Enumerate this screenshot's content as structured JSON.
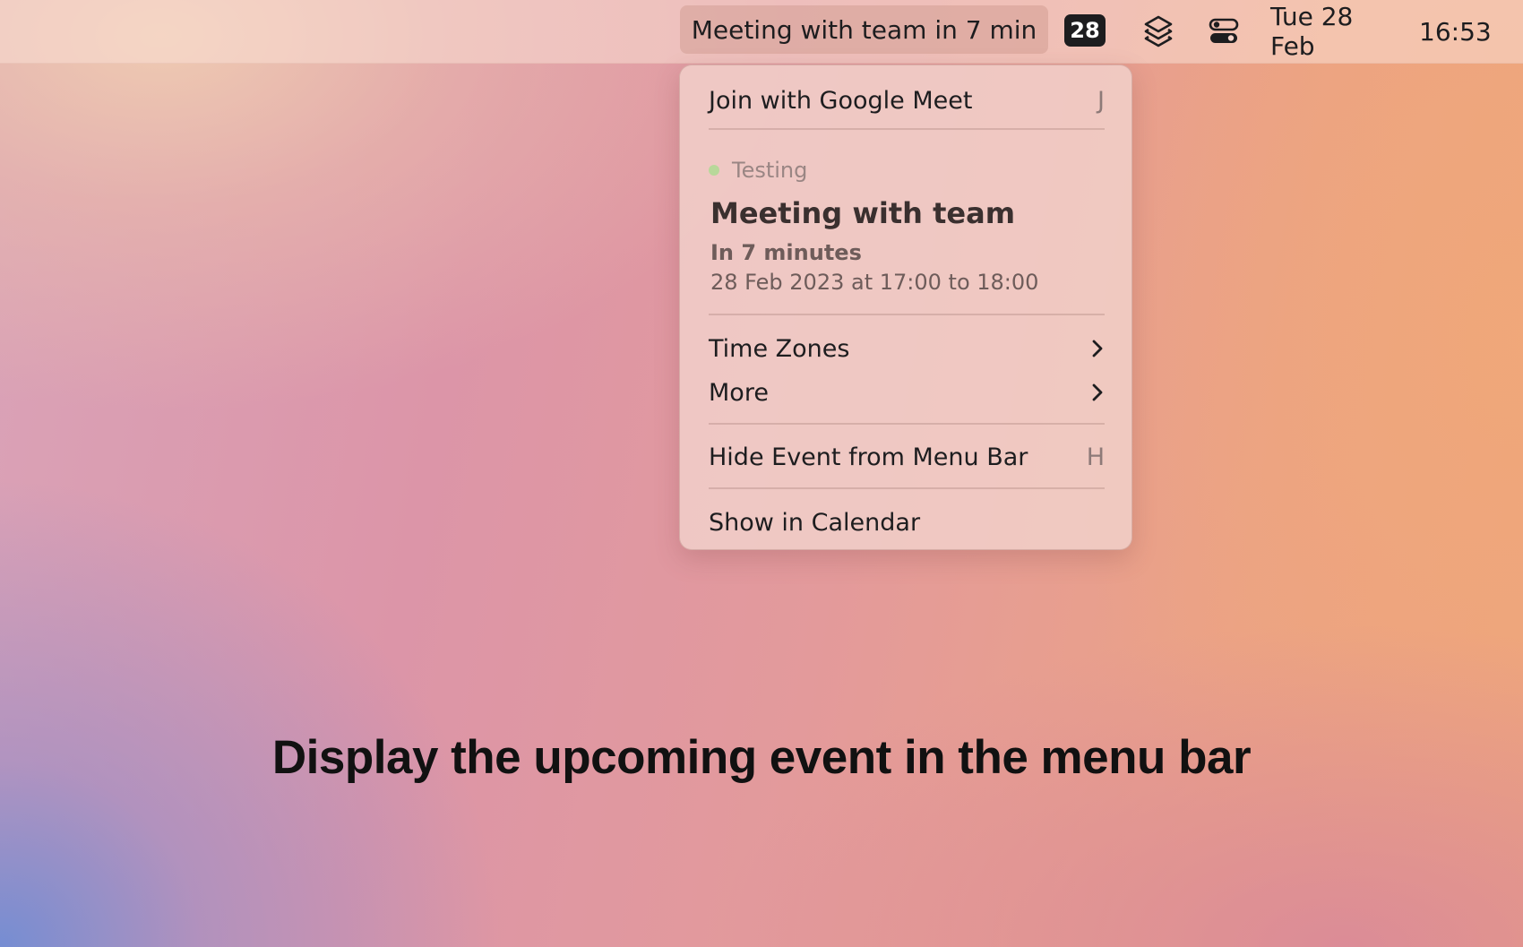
{
  "menubar": {
    "event_label": "Meeting with team in 7 min",
    "calendar_badge": "28",
    "layers_icon": "layers-icon",
    "control_center_icon": "control-center-toggle-icon",
    "date": "Tue 28 Feb",
    "time": "16:53"
  },
  "dropdown": {
    "join": {
      "label": "Join with Google Meet",
      "shortcut": "J"
    },
    "event": {
      "calendar_name": "Testing",
      "calendar_color": "#b8d89a",
      "title": "Meeting with team",
      "relative_time": "In 7 minutes",
      "datetime": "28 Feb 2023 at 17:00 to 18:00"
    },
    "time_zones": {
      "label": "Time Zones",
      "icon": "chevron-right-icon"
    },
    "more": {
      "label": "More",
      "icon": "chevron-right-icon"
    },
    "hide": {
      "label": "Hide Event from Menu Bar",
      "shortcut": "H"
    },
    "show": {
      "label": "Show in Calendar"
    }
  },
  "caption": "Display the upcoming event in the menu bar"
}
